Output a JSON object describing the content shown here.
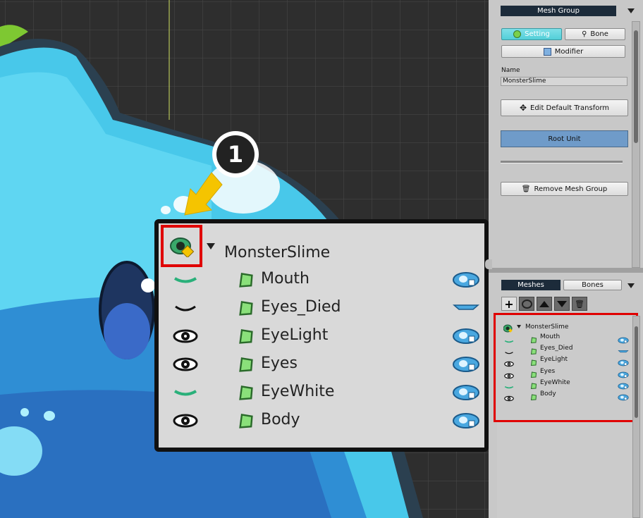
{
  "panel": {
    "header_tab": "Mesh Group",
    "setting_label": "Setting",
    "bone_label": "Bone",
    "modifier_label": "Modifier",
    "name_label": "Name",
    "name_value": "MonsterSlime",
    "edit_transform_label": "Edit Default Transform",
    "root_unit_label": "Root Unit",
    "remove_label": "Remove Mesh Group"
  },
  "bottom_panel": {
    "tab_meshes": "Meshes",
    "tab_bones": "Bones"
  },
  "tree": {
    "root": "MonsterSlime",
    "items": [
      {
        "label": "Mouth",
        "eye": "closed-smile"
      },
      {
        "label": "Eyes_Died",
        "eye": "closed"
      },
      {
        "label": "EyeLight",
        "eye": "open"
      },
      {
        "label": "Eyes",
        "eye": "open"
      },
      {
        "label": "EyeWhite",
        "eye": "closed-smile"
      },
      {
        "label": "Body",
        "eye": "open"
      }
    ]
  },
  "callout": {
    "step_number": "1"
  },
  "colors": {
    "highlight": "#e00000",
    "arrow": "#f5c400",
    "accent_button": "#52cfd8",
    "root_unit": "#6f9bc9"
  }
}
